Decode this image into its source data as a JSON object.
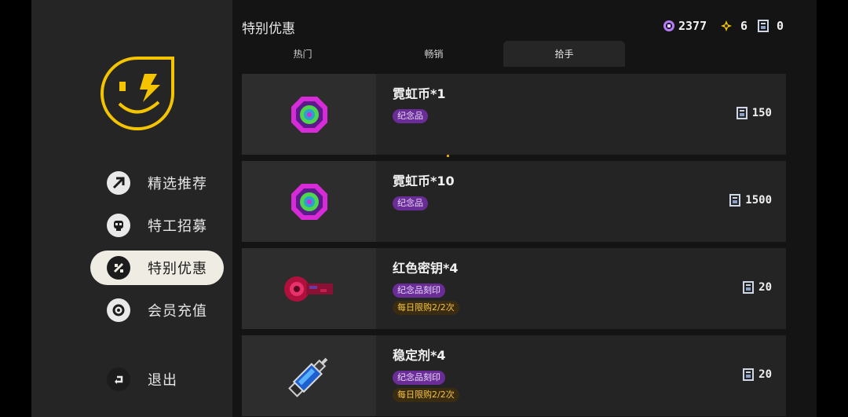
{
  "sidebar": {
    "nav": [
      {
        "label": "精选推荐",
        "icon": "recommend-icon",
        "active": false
      },
      {
        "label": "特工招募",
        "icon": "agent-recruit-icon",
        "active": false
      },
      {
        "label": "特别优惠",
        "icon": "special-offer-icon",
        "active": true
      },
      {
        "label": "会员充值",
        "icon": "membership-icon",
        "active": false
      }
    ],
    "exit_label": "退出"
  },
  "header": {
    "title": "特别优惠",
    "currencies": [
      {
        "icon": "neon-coin-icon",
        "value": "2377"
      },
      {
        "icon": "gold-gear-icon",
        "value": "6"
      },
      {
        "icon": "ticket-icon",
        "value": "0"
      }
    ]
  },
  "tabs": [
    {
      "label": "热门",
      "active": false
    },
    {
      "label": "畅销",
      "active": false
    },
    {
      "label": "拾手",
      "active": true
    }
  ],
  "items": [
    {
      "name": "霓虹币*1",
      "badge": "纪念品",
      "limit": "",
      "price": "150",
      "icon": "neon-coin-icon"
    },
    {
      "name": "霓虹币*10",
      "badge": "纪念品",
      "limit": "",
      "price": "1500",
      "icon": "neon-coin-icon"
    },
    {
      "name": "红色密钥*4",
      "badge": "纪念品刻印",
      "limit": "每日限购2/2次",
      "price": "20",
      "icon": "red-key-icon"
    },
    {
      "name": "稳定剂*4",
      "badge": "纪念品刻印",
      "limit": "每日限购2/2次",
      "price": "20",
      "icon": "stabilizer-syringe-icon"
    }
  ],
  "colors": {
    "accent_gold": "#f4c400",
    "badge_purple": "#6a2d97",
    "limit_text": "#f4c242",
    "neon_magenta": "#d62bd6",
    "neon_green": "#4cd64c"
  }
}
